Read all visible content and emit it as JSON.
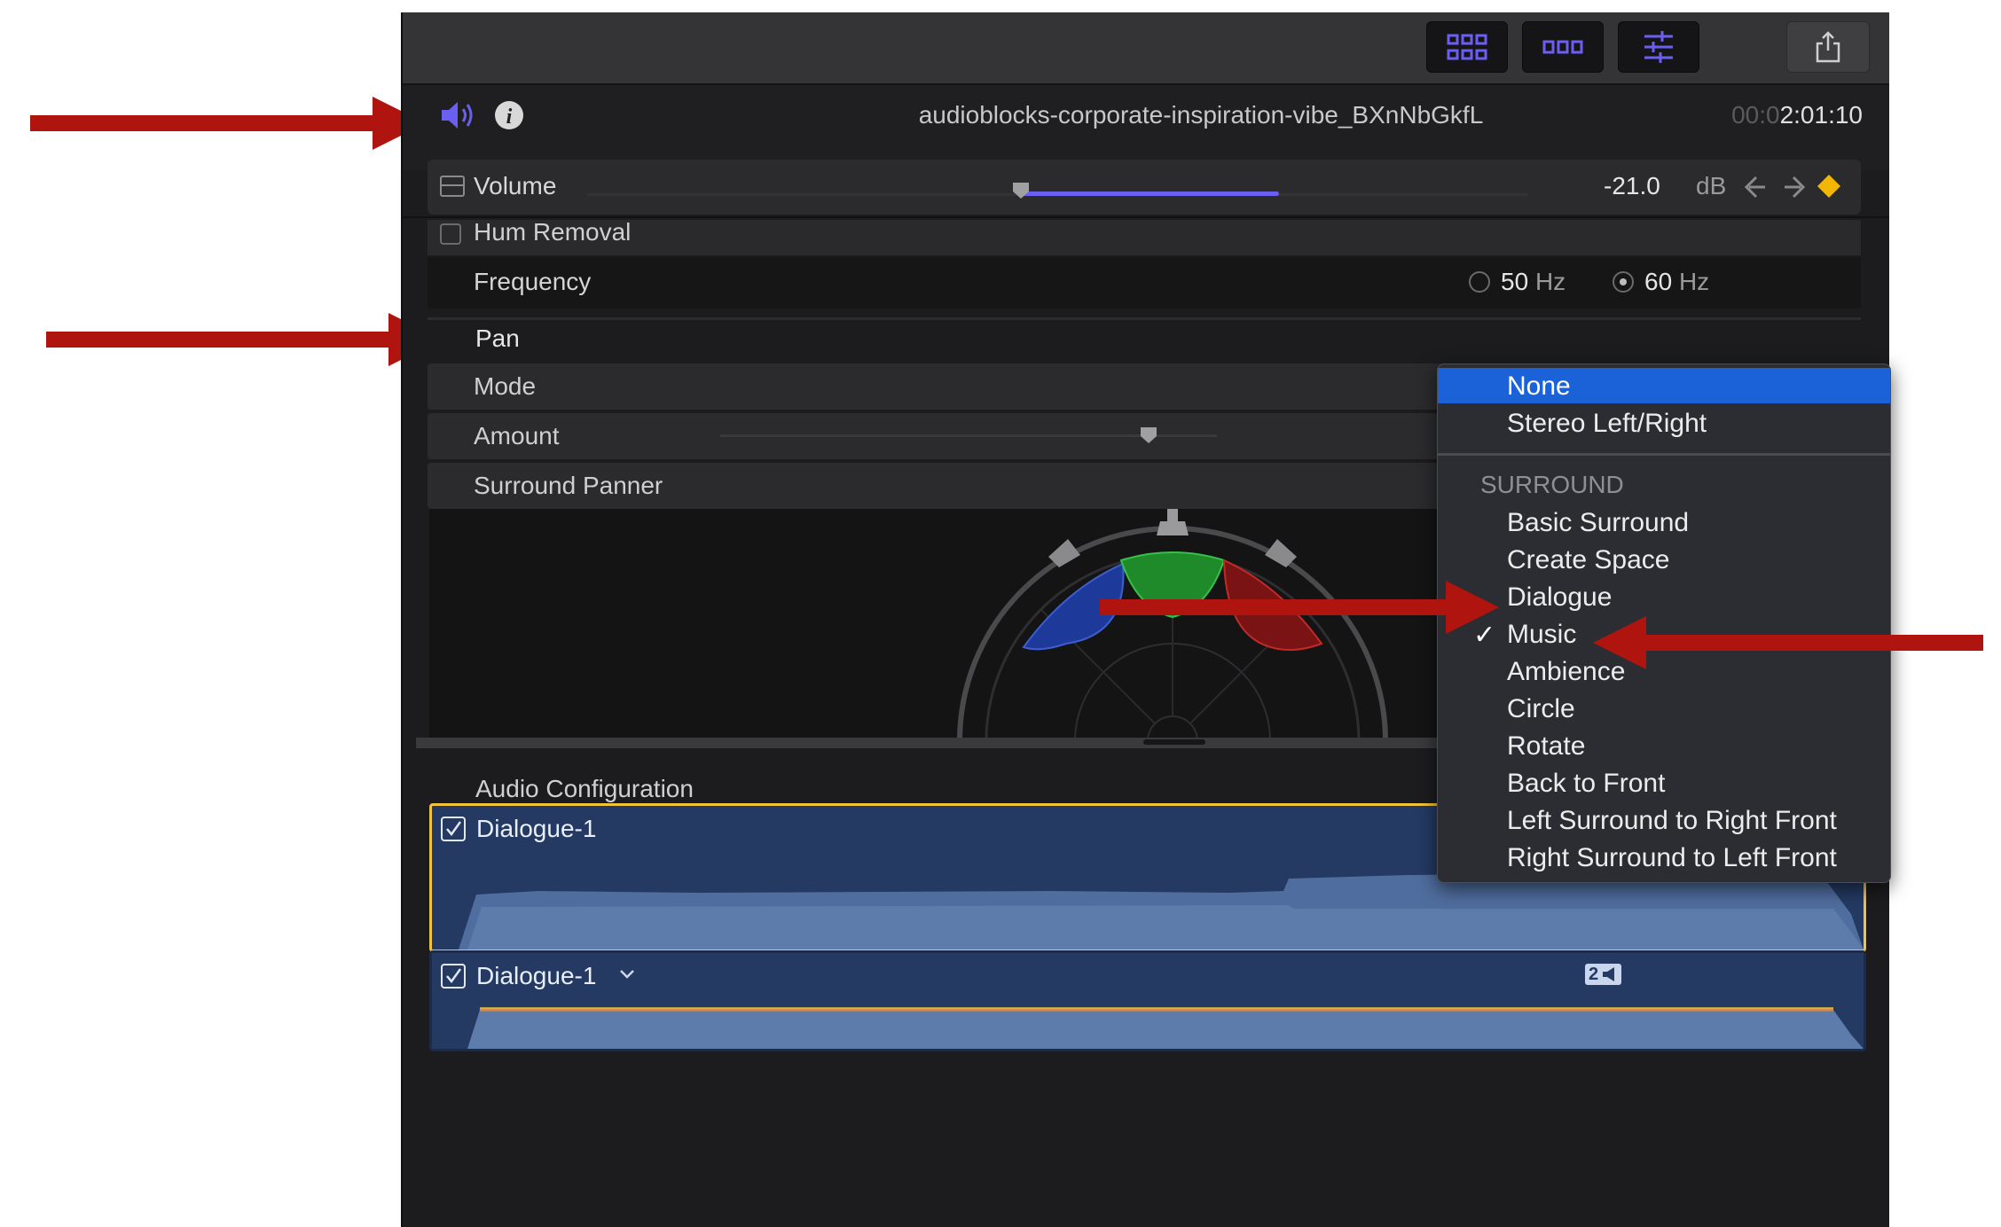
{
  "toolbar": {
    "buttons": [
      "browser-grid",
      "timeline-grid",
      "inspector-sliders"
    ],
    "share_icon": "share-icon"
  },
  "header": {
    "speaker_icon": "speaker-icon",
    "info_icon": "info-icon",
    "clip_title": "audioblocks-corporate-inspiration-vibe_BXnNbGkfL",
    "timecode_dim": "00:0",
    "timecode": "2:01:10"
  },
  "volume": {
    "label": "Volume",
    "value": "-21.0",
    "unit": "dB",
    "level_percent": 44
  },
  "hum_removal": {
    "label": "Hum Removal",
    "checked": false
  },
  "frequency": {
    "label": "Frequency",
    "option_50": "50",
    "option_60": "60",
    "unit": "Hz",
    "selected": "60"
  },
  "pan": {
    "title": "Pan",
    "mode_label": "Mode",
    "amount_label": "Amount",
    "surround_panner_label": "Surround Panner"
  },
  "audio_configuration": {
    "title": "Audio Configuration",
    "clips": [
      {
        "name": "Dialogue-1",
        "checked": true
      },
      {
        "name": "Dialogue-1",
        "checked": true,
        "badge": "2"
      }
    ]
  },
  "mode_menu": {
    "top_items": [
      "None",
      "Stereo Left/Right"
    ],
    "section": "SURROUND",
    "surround_items": [
      "Basic Surround",
      "Create Space",
      "Dialogue",
      "Music",
      "Ambience",
      "Circle",
      "Rotate",
      "Back to Front",
      "Left Surround to Right Front",
      "Right Surround to Left Front"
    ],
    "highlighted": "None",
    "checked": "Music",
    "check_mark": "✓"
  },
  "colors": {
    "accent": "#6a5ff0",
    "menu_highlight": "#1b62d8",
    "annotation_arrow": "#b0140e",
    "keyframe": "#f2b705"
  }
}
